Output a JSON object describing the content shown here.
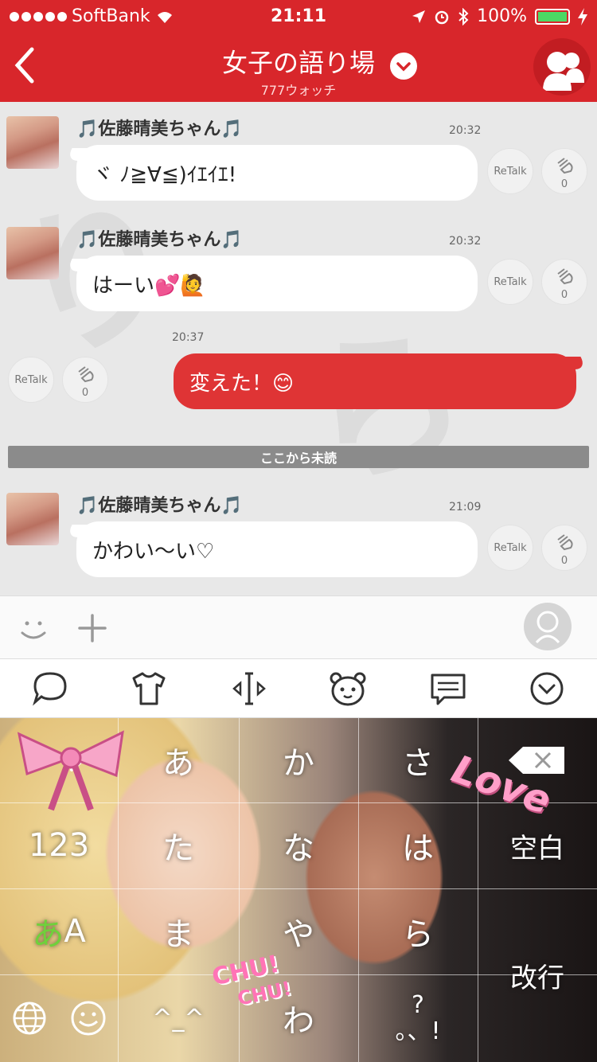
{
  "status_bar": {
    "carrier": "SoftBank",
    "time": "21:11",
    "battery": "100%"
  },
  "header": {
    "title": "女子の語り場",
    "subtitle": "777ウォッチ"
  },
  "messages": [
    {
      "sender": "🎵佐藤晴美ちゃん🎵",
      "time": "20:32",
      "text": "ヾ ﾉ≧∀≦)ｲｴｲｴ!",
      "retalk": "ReTalk",
      "claps": "0"
    },
    {
      "sender": "🎵佐藤晴美ちゃん🎵",
      "time": "20:32",
      "text": "はーい💕🙋",
      "retalk": "ReTalk",
      "claps": "0"
    },
    {
      "time": "20:37",
      "text": "変えた！😊",
      "retalk": "ReTalk",
      "claps": "0",
      "mine": true
    },
    {
      "sender": "🎵佐藤晴美ちゃん🎵",
      "time": "21:09",
      "text": "かわい〜い♡",
      "retalk": "ReTalk",
      "claps": "0"
    }
  ],
  "unread_divider": "ここから未読",
  "keyboard": {
    "rows": [
      [
        "あ",
        "か",
        "さ"
      ],
      [
        "123",
        "た",
        "な",
        "は",
        "空白"
      ],
      [
        "あA",
        "ま",
        "や",
        "ら",
        "改行"
      ],
      [
        "^_^",
        "わ",
        "?\n。、!"
      ]
    ],
    "stickers": {
      "love": "Love",
      "chu1": "CHU!",
      "chu2": "CHU!"
    }
  },
  "colors": {
    "brand_red": "#d8262b",
    "bubble_red": "#df3435",
    "battery_green": "#4cd964"
  }
}
